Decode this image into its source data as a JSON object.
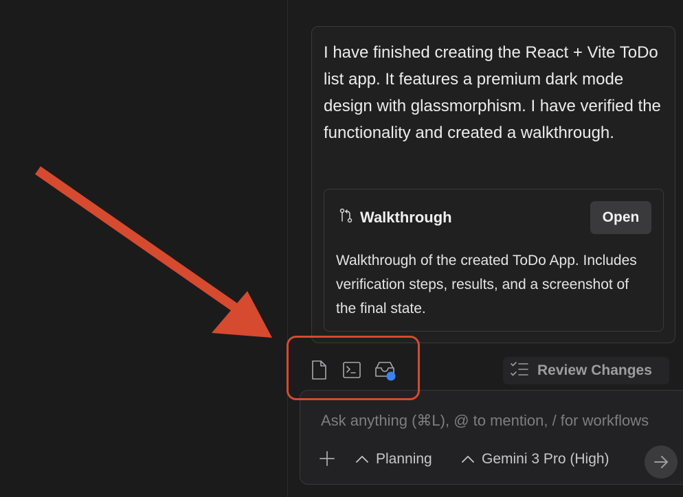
{
  "message": {
    "text": "I have finished creating the React + Vite ToDo list app. It features a premium dark mode design with glassmorphism. I have verified the functionality and created a walkthrough."
  },
  "artifact": {
    "icon": "git-compare-icon",
    "title": "Walkthrough",
    "open_label": "Open",
    "description": "Walkthrough of the created ToDo App. Includes verification steps, results, and a screenshot of the final state."
  },
  "toolbar": {
    "icons": [
      "file-icon",
      "terminal-icon",
      "inbox-icon"
    ],
    "review_label": "Review Changes",
    "review_icon": "checklist-icon"
  },
  "chat_input": {
    "placeholder": "Ask anything (⌘L), @ to mention, / for workflows",
    "mode_label": "Planning",
    "model_label": "Gemini 3 Pro (High)"
  },
  "colors": {
    "annotation": "#d64a2f",
    "notification_dot": "#3b82f6"
  }
}
